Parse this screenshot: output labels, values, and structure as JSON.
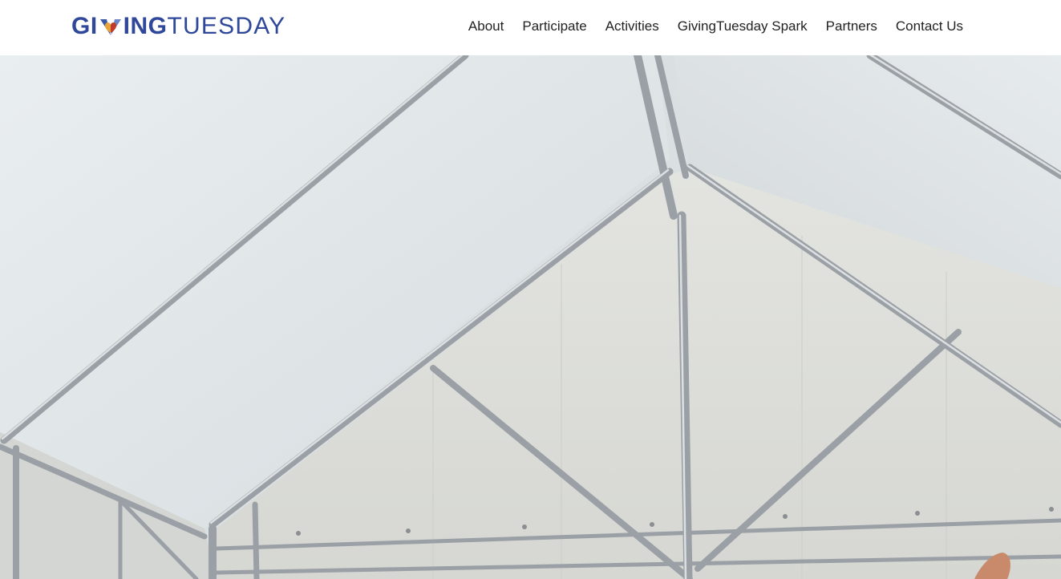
{
  "header": {
    "logo": {
      "part1": "GI",
      "part2": "ING",
      "part3": "TUESDAY",
      "icon": "hands-heart-icon",
      "colors": {
        "text": "#2f4899",
        "heart_left": "#e8a33b",
        "heart_right": "#c0392b"
      }
    },
    "nav": [
      {
        "label": "About"
      },
      {
        "label": "Participate"
      },
      {
        "label": "Activities"
      },
      {
        "label": "GivingTuesday Spark"
      },
      {
        "label": "Partners"
      },
      {
        "label": "Contact Us"
      }
    ]
  },
  "hero": {
    "image": "tent-interior-frame-photo"
  }
}
